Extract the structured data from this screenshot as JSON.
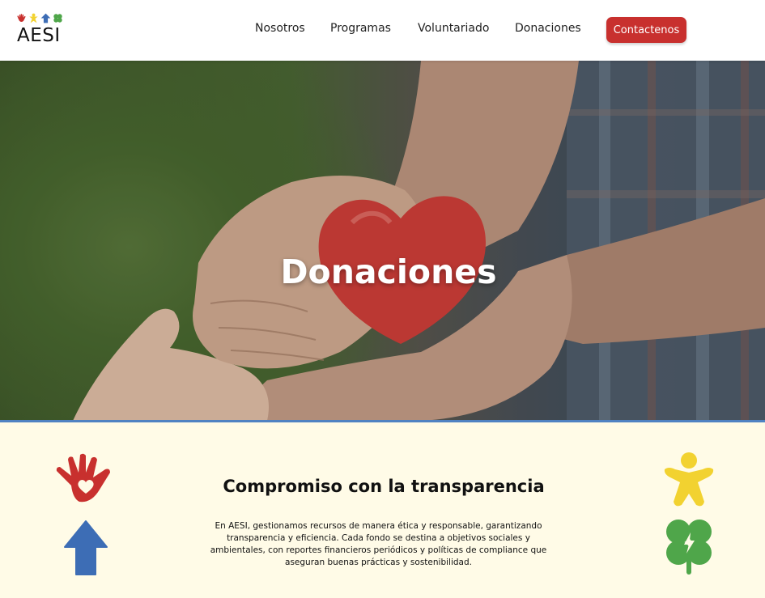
{
  "header": {
    "logo_text": "AESI",
    "logo_icons": [
      "hand-icon",
      "person-icon",
      "arrow-up-icon",
      "clover-icon"
    ],
    "nav": [
      "Nosotros",
      "Programas",
      "Voluntariado",
      "Donaciones"
    ],
    "contact_label": "Contactenos"
  },
  "hero": {
    "title": "Donaciones"
  },
  "transparency": {
    "title": "Compromiso con la transparencia",
    "body": "En AESI, gestionamos recursos de manera ética y responsable, garantizando transparencia y eficiencia. Cada fondo se destina a objetivos sociales y ambientales, con reportes financieros periódicos y políticas de compliance que aseguran buenas prácticas y sostenibilidad.",
    "decor_icons": [
      "hand-heart-icon",
      "arrow-up-icon",
      "person-icon",
      "clover-icon"
    ]
  },
  "colors": {
    "accent_red": "#c8302e",
    "blue": "#3d6db5",
    "yellow": "#f2d230",
    "green": "#4fa64a",
    "section_bg": "#fffbe7",
    "hero_border": "#4f82c2"
  }
}
